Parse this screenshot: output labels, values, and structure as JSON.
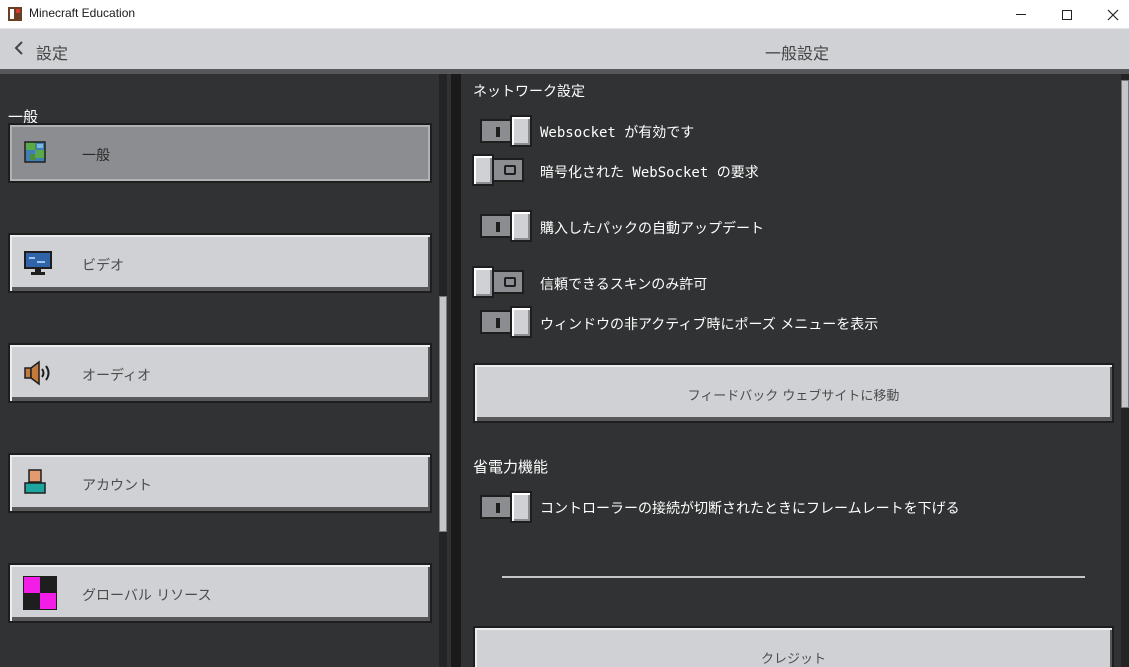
{
  "window": {
    "title": "Minecraft Education",
    "minimize_glyph": "—",
    "maximize_glyph": "☐",
    "close_glyph": "✕"
  },
  "header": {
    "back_glyph": "〈",
    "back_label": "設定",
    "page_title": "一般設定"
  },
  "sidebar": {
    "section_label": "一般",
    "items": [
      {
        "label": "一般",
        "icon": "globe-icon",
        "selected": true
      },
      {
        "label": "ビデオ",
        "icon": "monitor-icon",
        "selected": false
      },
      {
        "label": "オーディオ",
        "icon": "speaker-icon",
        "selected": false
      },
      {
        "label": "アカウント",
        "icon": "account-icon",
        "selected": false
      },
      {
        "label": "グローバル リソース",
        "icon": "global-resources-icon",
        "selected": false
      }
    ]
  },
  "main": {
    "network_section": "ネットワーク設定",
    "toggles": [
      {
        "label": "Websocket が有効です",
        "on": true
      },
      {
        "label": "暗号化された WebSocket の要求",
        "on": false
      },
      {
        "label": "購入したパックの自動アップデート",
        "on": true
      },
      {
        "label": "信頼できるスキンのみ許可",
        "on": false
      },
      {
        "label": "ウィンドウの非アクティブ時にポーズ メニューを表示",
        "on": true
      }
    ],
    "feedback_button": "フィードバック ウェブサイトに移動",
    "power_section": "省電力機能",
    "power_toggle": {
      "label": "コントローラーの接続が切断されたときにフレームレートを下げる",
      "on": true
    },
    "credits_button": "クレジット"
  },
  "colors": {
    "panel_bg": "#313233",
    "button_bg": "#d0d1d4",
    "selected_bg": "#8c8d90",
    "text_light": "#ffffff",
    "text_dark": "#4c4c4c"
  }
}
